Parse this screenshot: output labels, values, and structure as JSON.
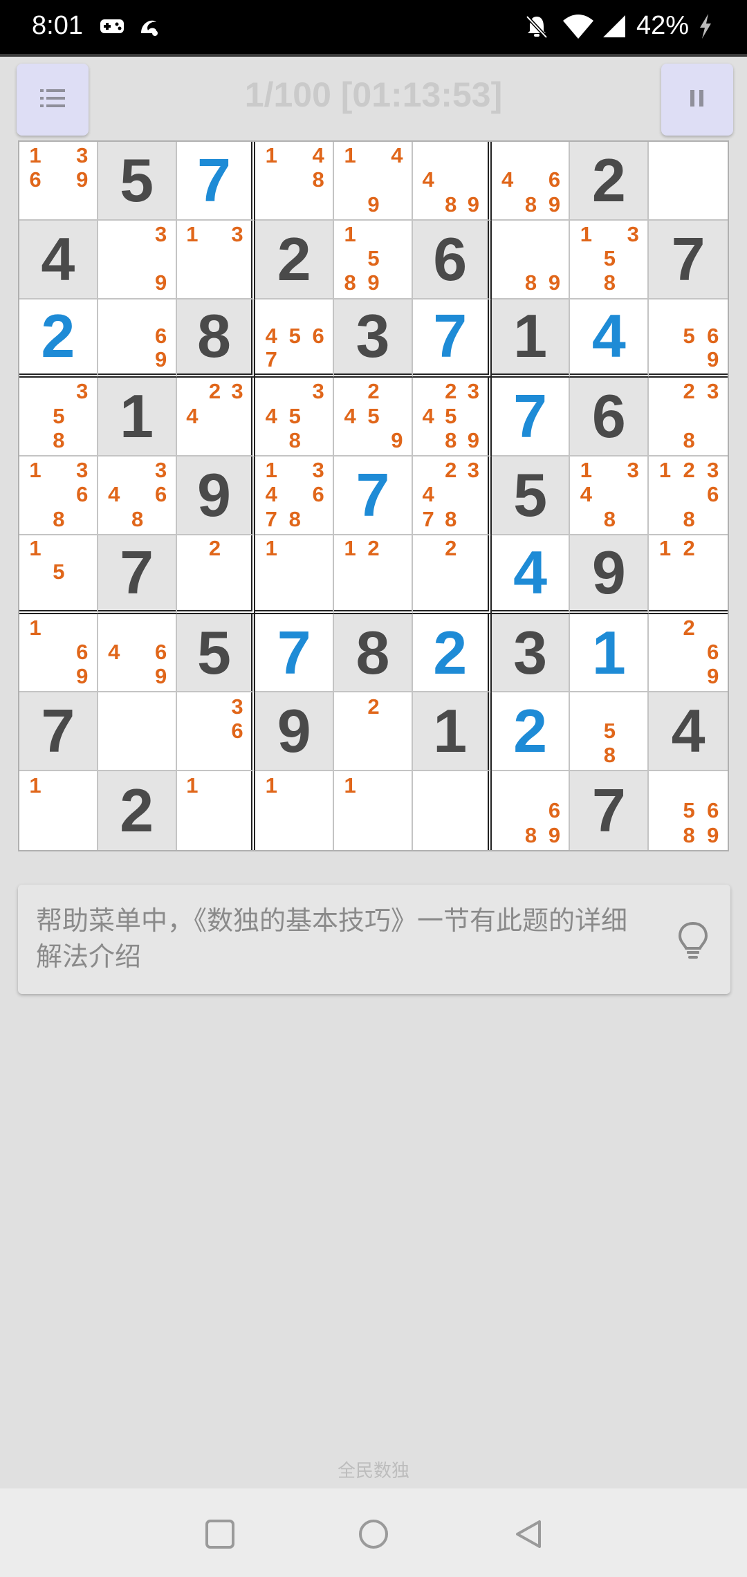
{
  "status_bar": {
    "time": "8:01",
    "battery": "42%",
    "icons": [
      "gamepad-icon",
      "uc-browser-icon",
      "bell-off-icon",
      "wifi-icon",
      "cell-signal-icon",
      "charging-icon"
    ]
  },
  "header": {
    "title": "1/100 [01:13:53]",
    "menu_icon": "list-icon",
    "pause_icon": "pause-icon"
  },
  "colors": {
    "given_digit": "#4a4a4a",
    "user_digit": "#1e8bd6",
    "note_digit": "#e0661a",
    "given_cell_bg": "#e4e4e4",
    "button_bg": "#dedef5"
  },
  "board": {
    "cells": [
      [
        {
          "notes": "1 36 9"
        },
        {
          "given": "5"
        },
        {
          "user": "7"
        },
        {
          "notes": "1 4  8"
        },
        {
          "notes": "1 4    9"
        },
        {
          "notes": "   4   89"
        },
        {
          "notes": "   4 6 89"
        },
        {
          "given": "2"
        },
        {
          "notes": ""
        }
      ],
      [
        {
          "given": "4"
        },
        {
          "notes": "  3     9"
        },
        {
          "notes": "1 3"
        },
        {
          "given": "2"
        },
        {
          "notes": "1   5 89"
        },
        {
          "given": "6"
        },
        {
          "notes": "       89"
        },
        {
          "notes": "1 3 5  8"
        },
        {
          "given": "7"
        }
      ],
      [
        {
          "user": "2"
        },
        {
          "notes": "     6  9"
        },
        {
          "given": "8"
        },
        {
          "notes": "   4567"
        },
        {
          "given": "3"
        },
        {
          "user": "7"
        },
        {
          "given": "1"
        },
        {
          "user": "4"
        },
        {
          "notes": "    56  9"
        }
      ],
      [
        {
          "notes": "  3 5  8"
        },
        {
          "given": "1"
        },
        {
          "notes": " 234"
        },
        {
          "notes": "  345  8"
        },
        {
          "notes": " 2 45   9"
        },
        {
          "notes": " 2345  89"
        },
        {
          "user": "7"
        },
        {
          "given": "6"
        },
        {
          "notes": " 23    8"
        }
      ],
      [
        {
          "notes": "1 3  6 8"
        },
        {
          "notes": "  34 6 8"
        },
        {
          "given": "9"
        },
        {
          "notes": "1 34 678"
        },
        {
          "user": "7"
        },
        {
          "notes": " 234  78"
        },
        {
          "given": "5"
        },
        {
          "notes": "1 34   8"
        },
        {
          "notes": "123  6 8"
        }
      ],
      [
        {
          "notes": "1   5"
        },
        {
          "given": "7"
        },
        {
          "notes": " 2"
        },
        {
          "notes": "1"
        },
        {
          "notes": "12"
        },
        {
          "notes": " 2"
        },
        {
          "user": "4"
        },
        {
          "given": "9"
        },
        {
          "notes": "12"
        }
      ],
      [
        {
          "notes": "1    6  9"
        },
        {
          "notes": "   4 6  9"
        },
        {
          "given": "5"
        },
        {
          "user": "7"
        },
        {
          "given": "8"
        },
        {
          "user": "2"
        },
        {
          "given": "3"
        },
        {
          "user": "1"
        },
        {
          "notes": " 2   6  9"
        }
      ],
      [
        {
          "given": "7"
        },
        {
          "notes": ""
        },
        {
          "notes": "  3  6"
        },
        {
          "given": "9"
        },
        {
          "notes": " 2"
        },
        {
          "given": "1"
        },
        {
          "user": "2"
        },
        {
          "notes": "    5  8"
        },
        {
          "given": "4"
        }
      ],
      [
        {
          "notes": "1"
        },
        {
          "given": "2"
        },
        {
          "notes": "1"
        },
        {
          "notes": "1"
        },
        {
          "notes": "1"
        },
        {
          "notes": ""
        },
        {
          "notes": "     6 89"
        },
        {
          "given": "7"
        },
        {
          "notes": "    56 89"
        }
      ]
    ]
  },
  "hint": {
    "text": "帮助菜单中，《数独的基本技巧》一节有此题的详细解法介绍",
    "icon": "lightbulb-icon"
  },
  "footer": {
    "app_name": "全民数独"
  },
  "nav": [
    "recents-square-icon",
    "home-circle-icon",
    "back-triangle-icon"
  ]
}
